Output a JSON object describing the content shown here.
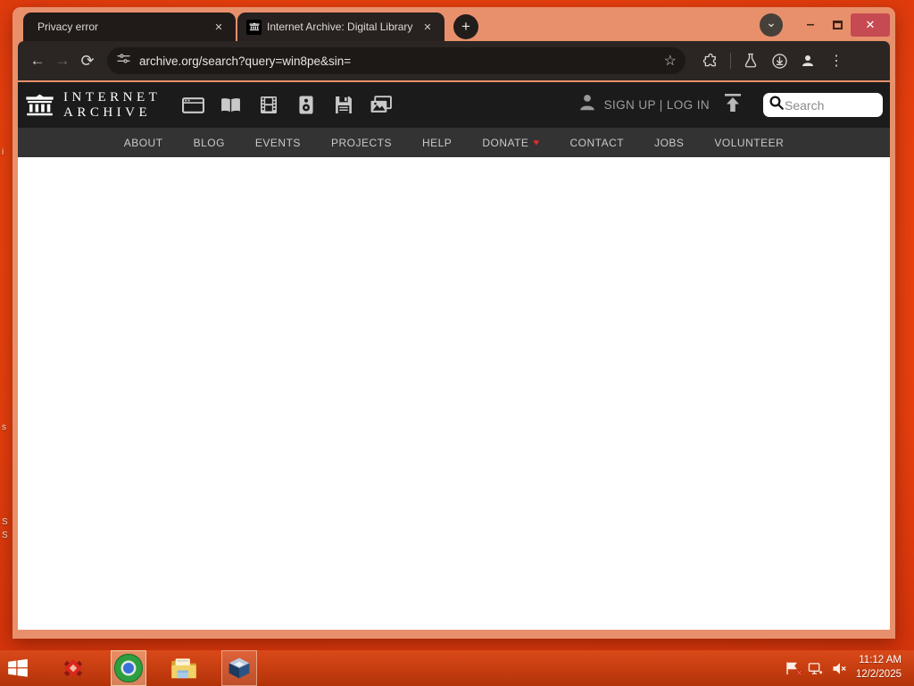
{
  "browser": {
    "tabs": [
      {
        "title": "Privacy error"
      },
      {
        "title": "Internet Archive: Digital Library"
      }
    ],
    "url": "archive.org/search?query=win8pe&sin="
  },
  "ia": {
    "logo_line1": "INTERNET",
    "logo_line2": "ARCHIVE",
    "media_icons": [
      "web",
      "texts",
      "video",
      "audio",
      "software",
      "images"
    ],
    "auth_text": "SIGN UP | LOG IN",
    "search_placeholder": "Search",
    "nav": [
      "ABOUT",
      "BLOG",
      "EVENTS",
      "PROJECTS",
      "HELP",
      "DONATE",
      "CONTACT",
      "JOBS",
      "VOLUNTEER"
    ]
  },
  "desktop": {
    "label_fragments": {
      "f0": "i",
      "f1": "s",
      "f2": "S",
      "f3": "S"
    }
  },
  "taskbar": {
    "time": "11:12 AM",
    "date": "12/2/2025"
  },
  "colors": {
    "desktop_red": "#e8400e",
    "window_frame": "#e8906c",
    "browser_chrome": "#2b2623",
    "ia_header": "#1b1b1b",
    "ia_nav": "#333333",
    "close_button": "#c64a52",
    "donate_heart": "#e02a2a",
    "chrome_green": "#2e9e3e",
    "chrome_blue": "#3a6fd8"
  }
}
